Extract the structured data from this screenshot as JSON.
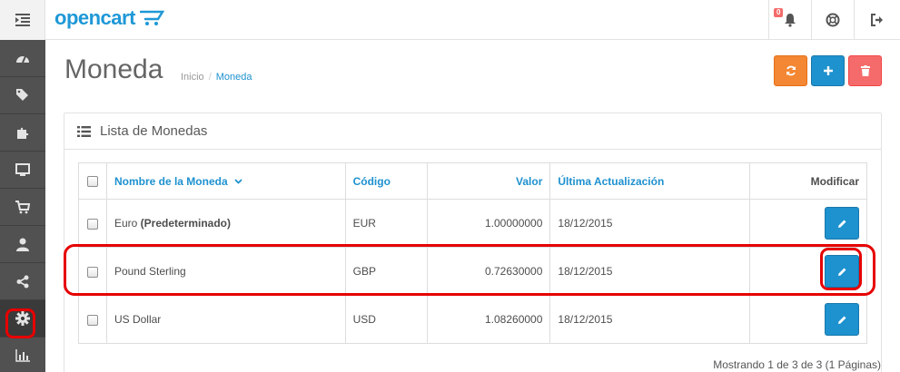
{
  "header": {
    "logo": "opencart",
    "notification_count": "0"
  },
  "sidebar": {
    "items": [
      {
        "icon": "dashboard-icon"
      },
      {
        "icon": "tags-icon"
      },
      {
        "icon": "puzzle-icon"
      },
      {
        "icon": "desktop-icon"
      },
      {
        "icon": "shopping-cart-icon"
      },
      {
        "icon": "user-icon"
      },
      {
        "icon": "share-icon"
      },
      {
        "icon": "gear-icon"
      },
      {
        "icon": "bar-chart-icon"
      }
    ]
  },
  "page": {
    "title": "Moneda",
    "breadcrumb": [
      "Inicio",
      "Moneda"
    ]
  },
  "panel": {
    "title": "Lista de Monedas"
  },
  "table": {
    "headers": {
      "name": "Nombre de la Moneda",
      "code": "Código",
      "value": "Valor",
      "updated": "Última Actualización",
      "action": "Modificar"
    },
    "rows": [
      {
        "name": "Euro",
        "default_label": "(Predeterminado)",
        "code": "EUR",
        "value": "1.00000000",
        "updated": "18/12/2015"
      },
      {
        "name": "Pound Sterling",
        "code": "GBP",
        "value": "0.72630000",
        "updated": "18/12/2015"
      },
      {
        "name": "US Dollar",
        "code": "USD",
        "value": "1.08260000",
        "updated": "18/12/2015"
      }
    ]
  },
  "pagination": {
    "info": "Mostrando 1 de 3 de 3 (1 Páginas)"
  },
  "colors": {
    "primary": "#1e91cf",
    "warning": "#f38733",
    "danger": "#f56b6b",
    "sidebar": "#515151",
    "highlight": "#e60000"
  }
}
